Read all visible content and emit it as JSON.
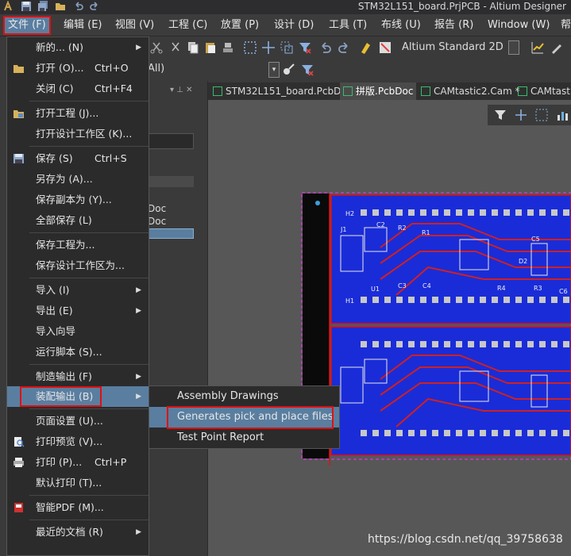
{
  "window": {
    "title": "STM32L151_board.PrjPCB - Altium Designer"
  },
  "menubar": {
    "items": [
      {
        "label": "文件 (F)",
        "name": "menu-file",
        "active": true
      },
      {
        "label": "编辑 (E)",
        "name": "menu-edit"
      },
      {
        "label": "视图 (V)",
        "name": "menu-view"
      },
      {
        "label": "工程 (C)",
        "name": "menu-project"
      },
      {
        "label": "放置 (P)",
        "name": "menu-place"
      },
      {
        "label": "设计 (D)",
        "name": "menu-design"
      },
      {
        "label": "工具 (T)",
        "name": "menu-tools"
      },
      {
        "label": "布线 (U)",
        "name": "menu-route"
      },
      {
        "label": "报告 (R)",
        "name": "menu-reports"
      },
      {
        "label": "Window (W)",
        "name": "menu-window"
      },
      {
        "label": "帮",
        "name": "menu-help"
      }
    ]
  },
  "toolbar": {
    "view_mode": "Altium Standard 2D",
    "filter_text": "All)"
  },
  "tabs": [
    {
      "label": "STM32L151_board.PcbDoc"
    },
    {
      "label": "拼版.PcbDoc",
      "active": true
    },
    {
      "label": "CAMtastic2.Cam *"
    },
    {
      "label": "CAMtastic"
    }
  ],
  "left_panel": {
    "rows": [
      "Doc",
      "Doc"
    ]
  },
  "file_menu": {
    "items": [
      {
        "label": "新的... (N)",
        "submenu": true
      },
      {
        "label": "打开 (O)...",
        "shortcut": "Ctrl+O",
        "icon": "folder-open-icon"
      },
      {
        "label": "关闭 (C)",
        "shortcut": "Ctrl+F4"
      },
      {
        "label": "打开工程 (J)...",
        "icon": "open-project-icon"
      },
      {
        "label": "打开设计工作区 (K)..."
      },
      {
        "label": "保存 (S)",
        "shortcut": "Ctrl+S",
        "icon": "save-icon"
      },
      {
        "label": "另存为 (A)..."
      },
      {
        "label": "保存副本为 (Y)..."
      },
      {
        "label": "全部保存 (L)"
      },
      {
        "label": "保存工程为..."
      },
      {
        "label": "保存设计工作区为..."
      },
      {
        "label": "导入 (I)",
        "submenu": true
      },
      {
        "label": "导出 (E)",
        "submenu": true
      },
      {
        "label": "导入向导"
      },
      {
        "label": "运行脚本 (S)..."
      },
      {
        "label": "制造输出 (F)",
        "submenu": true
      },
      {
        "label": "装配输出 (B)",
        "submenu": true,
        "highlighted": true
      },
      {
        "label": "页面设置 (U)..."
      },
      {
        "label": "打印预览 (V)...",
        "icon": "print-preview-icon"
      },
      {
        "label": "打印 (P)...",
        "shortcut": "Ctrl+P",
        "icon": "printer-icon"
      },
      {
        "label": "默认打印 (T)..."
      },
      {
        "label": "智能PDF (M)...",
        "icon": "pdf-icon"
      },
      {
        "label": "最近的文档 (R)",
        "submenu": true
      }
    ]
  },
  "assembly_submenu": {
    "items": [
      {
        "label": "Assembly Drawings"
      },
      {
        "label": "Generates pick and place files",
        "highlighted": true
      },
      {
        "label": "Test Point Report"
      }
    ]
  },
  "pcb": {
    "header_labels": [
      "H2",
      "J1",
      "C2",
      "R2",
      "R1",
      "U1",
      "C3",
      "C4",
      "H1",
      "D2",
      "R4",
      "R3",
      "C5",
      "C6"
    ]
  },
  "watermark": "https://blog.csdn.net/qq_39758638",
  "colors": {
    "highlight": "#5a7ea0",
    "callout": "#e01010",
    "pcb_board": "#1a2cd8"
  }
}
